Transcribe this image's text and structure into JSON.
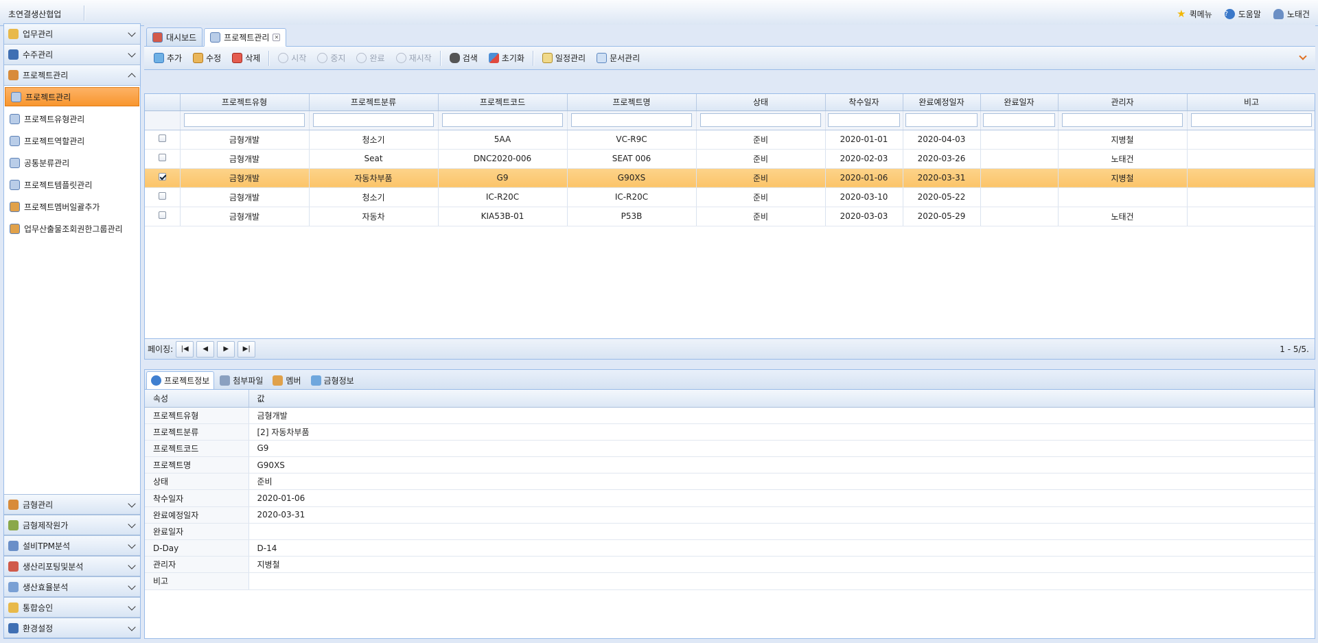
{
  "app": {
    "title": "초연결생산협업"
  },
  "topright": {
    "quick_menu": "퀵메뉴",
    "help": "도움말",
    "user": "노태건"
  },
  "sidebar": {
    "sections_top": [
      {
        "label": "업무관리",
        "expanded": false
      },
      {
        "label": "수주관리",
        "expanded": false
      },
      {
        "label": "프로젝트관리",
        "expanded": true
      }
    ],
    "items": [
      {
        "label": "프로젝트관리",
        "active": true
      },
      {
        "label": "프로젝트유형관리"
      },
      {
        "label": "프로젝트역할관리"
      },
      {
        "label": "공통분류관리"
      },
      {
        "label": "프로젝트템플릿관리"
      },
      {
        "label": "프로젝트멤버일괄추가"
      },
      {
        "label": "업무산출물조회권한그룹관리"
      }
    ],
    "sections_bottom": [
      {
        "label": "금형관리"
      },
      {
        "label": "금형제작원가"
      },
      {
        "label": "설비TPM분석"
      },
      {
        "label": "생산리포팅및분석"
      },
      {
        "label": "생산효율분석"
      },
      {
        "label": "통합승인"
      },
      {
        "label": "환경설정"
      }
    ]
  },
  "tabs": [
    {
      "label": "대시보드",
      "active": false
    },
    {
      "label": "프로젝트관리",
      "active": true
    }
  ],
  "toolbar": {
    "add": "추가",
    "edit": "수정",
    "delete": "삭제",
    "start": "시작",
    "stop": "중지",
    "complete": "완료",
    "restart": "재시작",
    "search": "검색",
    "reset": "초기화",
    "schedule": "일정관리",
    "documents": "문서관리"
  },
  "grid": {
    "columns": [
      "프로젝트유형",
      "프로젝트분류",
      "프로젝트코드",
      "프로젝트명",
      "상태",
      "착수일자",
      "완료예정일자",
      "완료일자",
      "관리자",
      "비고"
    ],
    "rows": [
      {
        "checked": false,
        "cells": [
          "금형개발",
          "청소기",
          "5AA",
          "VC-R9C",
          "준비",
          "2020-01-01",
          "2020-04-03",
          "",
          "지병철",
          ""
        ]
      },
      {
        "checked": false,
        "cells": [
          "금형개발",
          "Seat",
          "DNC2020-006",
          "SEAT 006",
          "준비",
          "2020-02-03",
          "2020-03-26",
          "",
          "노태건",
          ""
        ]
      },
      {
        "checked": true,
        "selected": true,
        "cells": [
          "금형개발",
          "자동차부품",
          "G9",
          "G90XS",
          "준비",
          "2020-01-06",
          "2020-03-31",
          "",
          "지병철",
          ""
        ]
      },
      {
        "checked": false,
        "cells": [
          "금형개발",
          "청소기",
          "IC-R20C",
          "IC-R20C",
          "준비",
          "2020-03-10",
          "2020-05-22",
          "",
          "",
          ""
        ]
      },
      {
        "checked": false,
        "cells": [
          "금형개발",
          "자동차",
          "KIA53B-01",
          "P53B",
          "준비",
          "2020-03-03",
          "2020-05-29",
          "",
          "노태건",
          ""
        ]
      }
    ]
  },
  "pager": {
    "label": "페이징:",
    "info": "1 - 5/5."
  },
  "detail_tabs": [
    {
      "label": "프로젝트정보",
      "active": true
    },
    {
      "label": "첨부파일"
    },
    {
      "label": "멤버"
    },
    {
      "label": "금형정보"
    }
  ],
  "props": {
    "header_key": "속성",
    "header_value": "값",
    "rows": [
      [
        "프로젝트유형",
        "금형개발"
      ],
      [
        "프로젝트분류",
        "[2] 자동차부품"
      ],
      [
        "프로젝트코드",
        "G9"
      ],
      [
        "프로젝트명",
        "G90XS"
      ],
      [
        "상태",
        "준비"
      ],
      [
        "착수일자",
        "2020-01-06"
      ],
      [
        "완료예정일자",
        "2020-03-31"
      ],
      [
        "완료일자",
        ""
      ],
      [
        "D-Day",
        "D-14"
      ],
      [
        "관리자",
        "지병철"
      ],
      [
        "비고",
        ""
      ]
    ]
  }
}
